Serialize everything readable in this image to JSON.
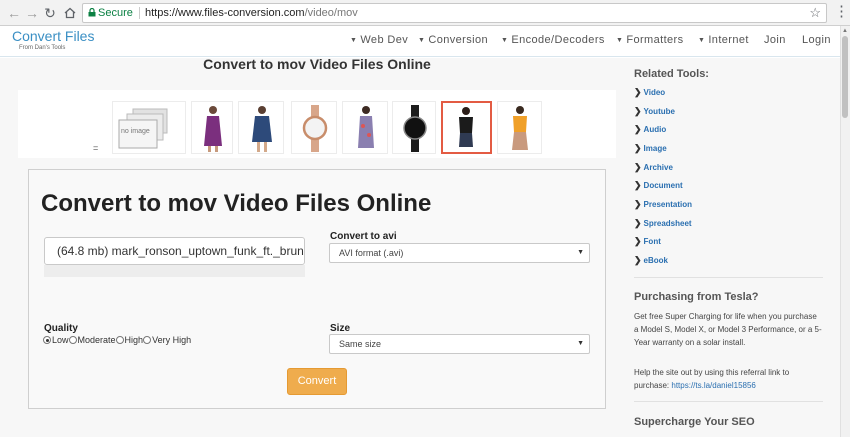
{
  "browser": {
    "secure_label": "Secure",
    "url_host": "https://www.files-conversion.com",
    "url_path": "/video/mov"
  },
  "header": {
    "logo_title": "Convert Files",
    "logo_subtitle": "From Dan's Tools",
    "nav": [
      {
        "label": "Web Dev",
        "has_caret": true
      },
      {
        "label": "Conversion",
        "has_caret": true
      },
      {
        "label": "Encode/Decoders",
        "has_caret": true
      },
      {
        "label": "Formatters",
        "has_caret": true
      },
      {
        "label": "Internet",
        "has_caret": true
      },
      {
        "label": "Join",
        "has_caret": false
      },
      {
        "label": "Login",
        "has_caret": false
      }
    ]
  },
  "main": {
    "page_title": "Convert to mov Video Files Online",
    "ad_placeholder_text": "no image",
    "ad_marker": "=",
    "card_title": "Convert to mov Video Files Online",
    "file_text": "(64.8 mb) mark_ronson_uptown_funk_ft._brun...",
    "convert_to_label": "Convert to avi",
    "format_selected": "AVI format (.avi)",
    "quality_label": "Quality",
    "quality_options": [
      "Low",
      "Moderate",
      "High",
      "Very High"
    ],
    "quality_selected": "Low",
    "size_label": "Size",
    "size_selected": "Same size",
    "convert_button": "Convert"
  },
  "sidebar": {
    "related_title": "Related Tools:",
    "links": [
      "Video",
      "Youtube",
      "Audio",
      "Image",
      "Archive",
      "Document",
      "Presentation",
      "Spreadsheet",
      "Font",
      "eBook"
    ],
    "tesla_title": "Purchasing from Tesla?",
    "tesla_text": "Get free Super Charging for life when you purchase a Model S, Model X, or Model 3 Performance, or a 5-Year warranty on a solar install.",
    "tesla_help": "Help the site out by using this referral link to purchase:",
    "tesla_link": "https://ts.la/daniel15856",
    "seo_title": "Supercharge Your SEO"
  },
  "colors": {
    "accent_blue": "#3a8fc4",
    "link_blue": "#2a6fb0",
    "convert_orange": "#efac4d",
    "selected_ad_border": "#e35b43",
    "secure_green": "#0b8043"
  }
}
